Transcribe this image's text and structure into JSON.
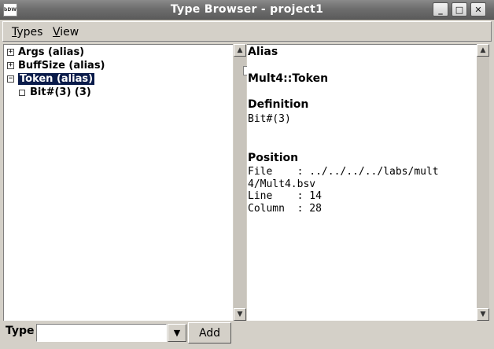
{
  "window": {
    "title": "Type Browser  - project1",
    "icon_text": "bDW"
  },
  "menubar": {
    "items": [
      {
        "accel": "T",
        "rest": "ypes"
      },
      {
        "accel": "V",
        "rest": "iew"
      }
    ]
  },
  "tree": {
    "items": [
      {
        "expander": "+",
        "label": "Args (alias)"
      },
      {
        "expander": "+",
        "label": "BuffSize (alias)"
      },
      {
        "expander": "−",
        "label": "Token (alias)"
      },
      {
        "label": "Bit#(3) (3)"
      }
    ]
  },
  "detail": {
    "kind": "Alias",
    "name": "Mult4::Token",
    "definition_heading": "Definition",
    "definition": "Bit#(3)",
    "position_heading": "Position",
    "position_lines": [
      "File    : ../../../../labs/mult",
      "4/Mult4.bsv",
      "Line    : 14",
      "Column  : 28"
    ]
  },
  "bottom": {
    "type_label": "Type",
    "type_value": "",
    "add_label": "Add"
  },
  "icons": {
    "scroll_up": "▲",
    "scroll_down": "▼",
    "combo": "▼",
    "minimize": "_",
    "maximize": "□",
    "close": "✕"
  }
}
